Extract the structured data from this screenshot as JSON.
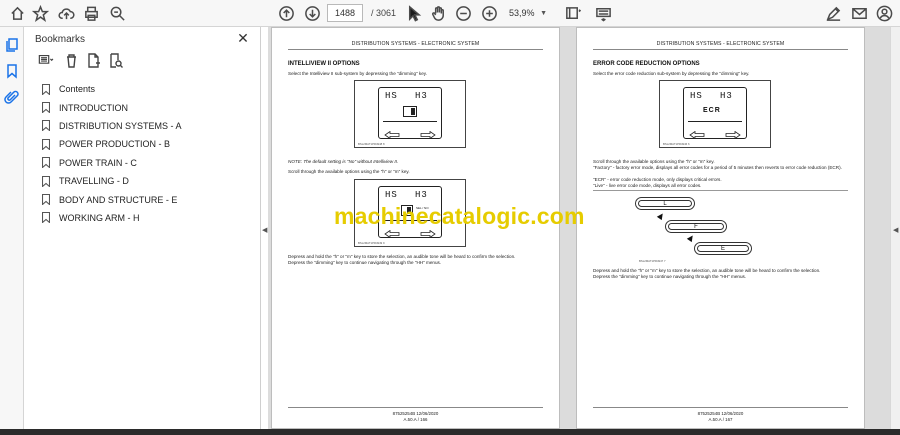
{
  "toolbar": {
    "page_current": "1488",
    "page_total": "/  3061",
    "zoom": "53,9%",
    "icons": [
      "home-icon",
      "star-icon",
      "cloud-upload-icon",
      "print-icon",
      "zoom-search-icon",
      "page-up-icon",
      "page-down-icon",
      "select-cursor-icon",
      "hand-icon",
      "zoom-out-icon",
      "zoom-in-icon",
      "fit-page-icon",
      "keyboard-icon",
      "sign-icon",
      "mail-icon",
      "account-icon"
    ]
  },
  "bookmarks": {
    "title": "Bookmarks",
    "close": "✕",
    "items": [
      {
        "label": "Contents"
      },
      {
        "label": "INTRODUCTION"
      },
      {
        "label": "DISTRIBUTION SYSTEMS - A"
      },
      {
        "label": "POWER PRODUCTION - B"
      },
      {
        "label": "POWER TRAIN - C"
      },
      {
        "label": "TRAVELLING - D"
      },
      {
        "label": "BODY AND STRUCTURE - E"
      },
      {
        "label": "WORKING ARM - H"
      }
    ]
  },
  "left_page": {
    "header": "DISTRIBUTION SYSTEMS - ELECTRONIC SYSTEM",
    "title": "INTELLIVIEW II OPTIONS",
    "para1": "Select the Intelliview II sub-system by depressing the \"dimming\" key.",
    "fig1": {
      "left": "HS",
      "right": "H3",
      "caption": "BSL2MAT1PR4948   8"
    },
    "note": "NOTE: The default setting is \"No\" without Intelliview II.",
    "para2": "Scroll through the available options using the \"h\" or \"m\" key.",
    "fig2": {
      "left": "HS",
      "right": "H3",
      "mini": "SEL / NO",
      "caption": "BSL2MAT1PR4949   9"
    },
    "para3": "Depress and hold the \"h\" or \"m\" key to store the selection, an audible tone will be heard to confirm the selection.",
    "para4": "Depress the \"dimming\" key to continue navigating through the \"HH\" menus.",
    "footer1": "87525254B 12/06/2020",
    "footer2": "A.50.A / 166"
  },
  "right_page": {
    "header": "DISTRIBUTION SYSTEMS - ELECTRONIC SYSTEM",
    "title": "ERROR CODE REDUCTION OPTIONS",
    "para1": "Select the error code reduction sub-system by depressing the \"dimming\" key.",
    "fig1": {
      "left": "HS",
      "right": "H3",
      "center": "ECR",
      "caption": "BSL2MAT1PR4946   6"
    },
    "para2": "Scroll through the available options using the \"h\" or \"m\" key.",
    "para3": "\"Factory\" - factory error mode, displays all error codes for a period of 5 minutes then reverts to error code reduction (ECR).",
    "para4": "\"ECR\" - error code reduction mode, only displays critical errors.",
    "para5": "\"Live\" - live error code mode, displays all error codes.",
    "fig2": {
      "pills": [
        "L",
        "F",
        "E"
      ],
      "caption": "BSL2MAT1PR4947   7"
    },
    "para6": "Depress and hold the \"h\" or \"m\" key to store the selection, an audible tone will be heard to confirm the selection.",
    "para7": "Depress the \"dimming\" key to continue navigating through the \"HH\" menus.",
    "footer1": "87525254B 12/06/2020",
    "footer2": "A.50.A / 167"
  },
  "watermark": "machinecatalogic.com",
  "colors": {
    "watermark": "#e6cc00",
    "rail_accent": "#1a73e8",
    "toolbar_bg": "#f7f7f7",
    "doc_bg": "#dcdcdc"
  }
}
